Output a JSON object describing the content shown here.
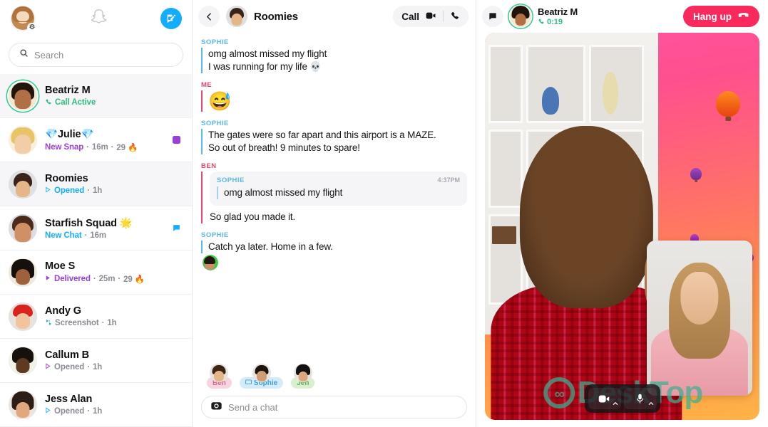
{
  "colors": {
    "brand_blue": "#13adff",
    "accent_red": "#f9295c",
    "green": "#2ebd82",
    "purple": "#9a3fd8",
    "sender_blue": "#5ab9e8",
    "sender_red": "#e8476a"
  },
  "sidebar": {
    "search": {
      "placeholder": "Search",
      "value": "",
      "icon": "search-icon"
    },
    "logo": "snapchat-ghost-icon",
    "new_chat_icon": "new-chat-icon",
    "profile_icon": "profile-avatar",
    "settings_icon": "gear-icon",
    "chats": [
      {
        "name": "Beatriz M",
        "status": "Call Active",
        "status_icon": "phone-icon",
        "status_color": "#2ebd82",
        "time": "",
        "badge": "",
        "active": true,
        "ring": true
      },
      {
        "name": "💎Julie💎",
        "status": "New Snap",
        "status_icon": "snap-square-icon",
        "status_color": "#9a3fd8",
        "time": "16m",
        "streak": "29 🔥",
        "badge": "purple-square",
        "active": false,
        "ring": false
      },
      {
        "name": "Roomies",
        "status": "Opened",
        "status_icon": "opened-arrow-icon",
        "status_color": "#13adff",
        "time": "1h",
        "badge": "",
        "active": true,
        "ring": false
      },
      {
        "name": "Starfish Squad 🌟",
        "status": "New Chat",
        "status_icon": "",
        "status_color": "#13adff",
        "time": "16m",
        "badge": "blue-bubble",
        "active": false,
        "ring": false
      },
      {
        "name": "Moe S",
        "status": "Delivered",
        "status_icon": "delivered-arrow-icon",
        "status_color": "#9a3fd8",
        "time": "25m",
        "streak": "29 🔥",
        "badge": "",
        "active": false,
        "ring": false
      },
      {
        "name": "Andy G",
        "status": "Screenshot",
        "status_icon": "screenshot-icon",
        "status_color": "#8c8c95",
        "time": "1h",
        "badge": "",
        "active": false,
        "ring": false
      },
      {
        "name": "Callum B",
        "status": "Opened",
        "status_icon": "opened-arrow-icon",
        "status_color": "#9a3fd8",
        "time": "1h",
        "badge": "",
        "active": false,
        "ring": false
      },
      {
        "name": "Jess Alan",
        "status": "Opened",
        "status_icon": "opened-arrow-icon",
        "status_color": "#13adff",
        "time": "1h",
        "badge": "",
        "active": false,
        "ring": false
      }
    ]
  },
  "chat": {
    "back_icon": "chevron-left-icon",
    "title": "Roomies",
    "call_label": "Call",
    "video_icon": "video-camera-icon",
    "phone_icon": "phone-icon",
    "messages": [
      {
        "sender": "SOPHIE",
        "sender_color": "#5ab9e8",
        "type": "text",
        "lines": [
          "omg almost missed my flight",
          "I was running for my life 💀"
        ]
      },
      {
        "sender": "ME",
        "sender_color": "#e8476a",
        "type": "emoji",
        "emoji": "😅"
      },
      {
        "sender": "SOPHIE",
        "sender_color": "#5ab9e8",
        "type": "text",
        "lines": [
          "The gates were so far apart and this airport is a MAZE.",
          "So out of breath! 9 minutes to spare!"
        ]
      },
      {
        "sender": "BEN",
        "sender_color": "#e8476a",
        "type": "reply",
        "quote_sender": "SOPHIE",
        "quote_text": "omg almost missed my flight",
        "quote_time": "4:37PM",
        "lines": [
          "So glad you made it."
        ]
      },
      {
        "sender": "SOPHIE",
        "sender_color": "#5ab9e8",
        "type": "text-sticker",
        "lines": [
          "Catch ya later. Home in a few."
        ],
        "sticker": "bitmoji-sticker"
      }
    ],
    "participants": [
      {
        "name": "Ben",
        "color": "#f7d4e0",
        "text_color": "#d06c90",
        "icon": ""
      },
      {
        "name": "Sophie",
        "color": "#d4ecfa",
        "text_color": "#3f9fd4",
        "icon": "screen-share-icon"
      },
      {
        "name": "Jen",
        "color": "#d8f0cf",
        "text_color": "#64ab53",
        "icon": ""
      }
    ],
    "composer": {
      "placeholder": "Send a chat",
      "value": "",
      "camera_icon": "camera-icon"
    }
  },
  "call": {
    "messages_icon": "chat-bubble-icon",
    "caller_name": "Beatriz M",
    "duration": "0:19",
    "duration_icon": "phone-icon",
    "hangup_label": "Hang up",
    "hangup_icon": "phone-down-icon",
    "controls": [
      {
        "name": "camera-toggle",
        "icon": "camera-icon",
        "chevron": "chevron-up-icon"
      },
      {
        "name": "mic-toggle",
        "icon": "microphone-icon",
        "chevron": "chevron-up-icon"
      }
    ],
    "watermark": "DeskTop"
  }
}
